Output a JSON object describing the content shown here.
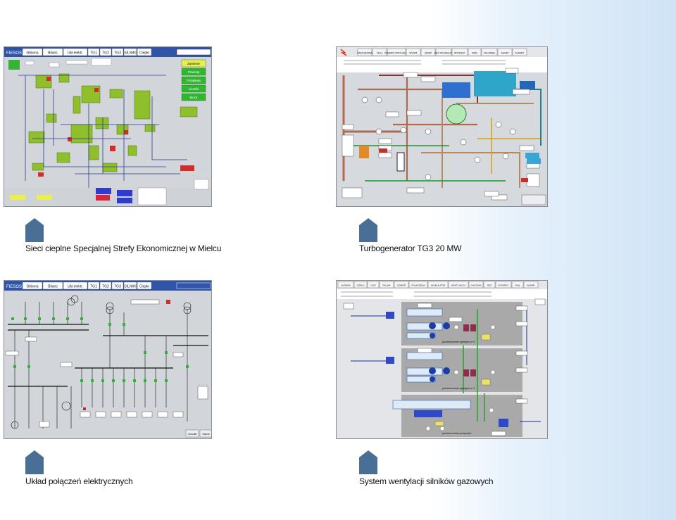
{
  "captions": {
    "c1": "Sieci cieplne Specjalnej Strefy Ekonomicznej w Mielcu",
    "c2": "Turbogenerator TG3 20 MW",
    "c3": "Układ połączeń elektrycznych",
    "c4": "System wentylacji silników gazowych"
  },
  "colors": {
    "marker": "#4a6f96",
    "scada_blue_header": "#2f54a8",
    "scada_green": "#2fb72f",
    "scada_bg": "#d4d8dc",
    "accent_bg": "#cfe3f6"
  },
  "screens": {
    "s1": {
      "brand": "FIESOS",
      "tabs": [
        "Główna",
        "Bilans",
        "Ukł.elektr.",
        "TG1",
        "TG2",
        "TG3",
        "SILNIKI",
        "Ciepło"
      ],
      "menu": [
        "Zasilenie",
        "Powroty",
        "Przepływy",
        "Liczniki",
        "Moce"
      ]
    },
    "s2": {
      "tabs": [
        "PARA WODNA",
        "OLEJ",
        "POMIARY SPECJALNE",
        "WYSPA",
        "SERW",
        "SIEĆ RYGINALNY",
        "WYKRESY",
        "ZAKŁ",
        "CHŁODNIA",
        "SILNIKI",
        "ALARMY"
      ]
    },
    "s3": {
      "brand": "FIESOS",
      "tabs": [
        "Główna",
        "Bilans",
        "Ukł.elektr.",
        "TG1",
        "TG2",
        "TG3",
        "SILNIKI",
        "Ciepło"
      ],
      "bottom_buttons": [
        "ośrodki",
        "transf."
      ]
    },
    "s4": {
      "tabs": [
        "GŁÓWNA",
        "CIEPŁO",
        "OLEJ",
        "PALIWA",
        "ODBIÓR",
        "POŁĄCZENIA",
        "AKUMULATOR",
        "WENTYLACJA",
        "CHŁODNIA",
        "SIEĆ",
        "WYKRESY",
        "ZAKŁ",
        "ALARMY"
      ],
      "room_labels": [
        "pomieszczenie agregatu nr 5",
        "pomieszczenie agregatu nr 3",
        "pomieszczenie pompowni"
      ]
    }
  }
}
